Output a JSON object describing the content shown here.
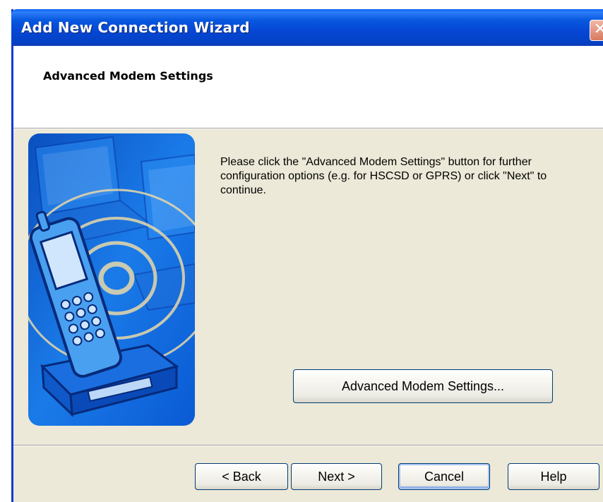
{
  "window": {
    "title": "Add New Connection Wizard",
    "close_glyph": "✕"
  },
  "header": {
    "title": "Advanced Modem Settings"
  },
  "illustration": {
    "icon": "mobile-phone-modem-illustration",
    "accent": "#0a5fd0"
  },
  "body": {
    "text": "Please click the \"Advanced Modem Settings\" button for further configuration options (e.g. for HSCSD or GPRS) or click \"Next\" to continue."
  },
  "buttons": {
    "advanced_label": "Advanced Modem Settings...",
    "back_label": "< Back",
    "next_label": "Next >",
    "cancel_label": "Cancel",
    "help_label": "Help"
  },
  "colors": {
    "titlebar": "#0546d4",
    "dialog_bg": "#ece9d8",
    "header_bg": "#ffffff",
    "button_border": "#003c74"
  }
}
